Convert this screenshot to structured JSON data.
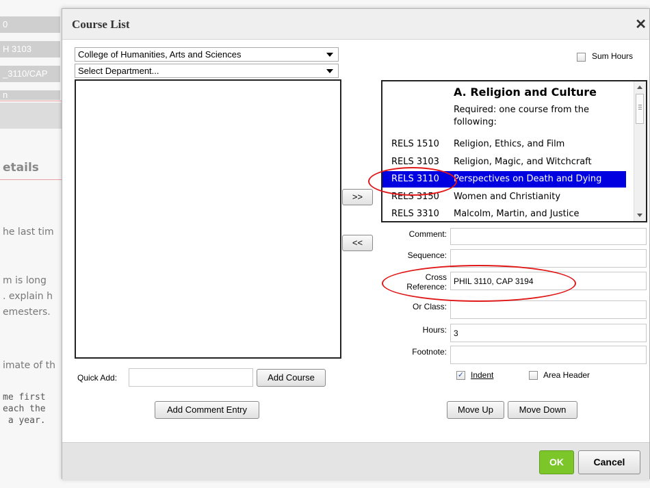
{
  "background": {
    "fields": [
      "0",
      "H 3103",
      "_3110/CAP",
      "n"
    ],
    "heading": "etails",
    "texts": [
      "he last tim",
      "m is long",
      ". explain h",
      "emesters.",
      "imate of th"
    ],
    "mono_lines": [
      "me first",
      "each the",
      " a year."
    ]
  },
  "dialog": {
    "title": "Course List",
    "close_icon": "close-icon",
    "college_select": "College of Humanities, Arts and Sciences",
    "department_select": "Select Department...",
    "sum_hours_label": "Sum Hours",
    "move_right_label": ">>",
    "move_left_label": "<<",
    "quick_add_label": "Quick Add:",
    "quick_add_value": "",
    "add_course_label": "Add Course",
    "add_comment_label": "Add Comment Entry",
    "courses": {
      "heading": "A. Religion and Culture",
      "note_line1": "Required: one course from the",
      "note_line2": "following:",
      "rows": [
        {
          "code": "RELS 1510",
          "name": "Religion, Ethics, and Film"
        },
        {
          "code": "RELS 3103",
          "name": "Religion, Magic, and Witchcraft"
        },
        {
          "code": "RELS 3110",
          "name": "Perspectives on Death and Dying"
        },
        {
          "code": "RELS 3150",
          "name": "Women and Christianity"
        },
        {
          "code": "RELS 3310",
          "name": "Malcolm, Martin, and Justice"
        }
      ],
      "selected_code": "RELS 3110"
    },
    "form": {
      "comment_label": "Comment:",
      "comment_value": "",
      "sequence_label": "Sequence:",
      "sequence_value": "",
      "cross_ref_label_1": "Cross",
      "cross_ref_label_2": "Reference:",
      "cross_ref_value": "PHIL 3110, CAP 3194",
      "or_class_label": "Or Class:",
      "or_class_value": "",
      "hours_label": "Hours:",
      "hours_value": "3",
      "footnote_label": "Footnote:",
      "footnote_value": ""
    },
    "indent_label": "Indent",
    "indent_checked": true,
    "area_header_label": "Area Header",
    "area_header_checked": false,
    "move_up_label": "Move Up",
    "move_down_label": "Move Down",
    "ok_label": "OK",
    "cancel_label": "Cancel",
    "colors": {
      "ok_green": "#7cc62a",
      "selection_blue": "#0000e0",
      "annotation_red": "#e01818"
    }
  }
}
